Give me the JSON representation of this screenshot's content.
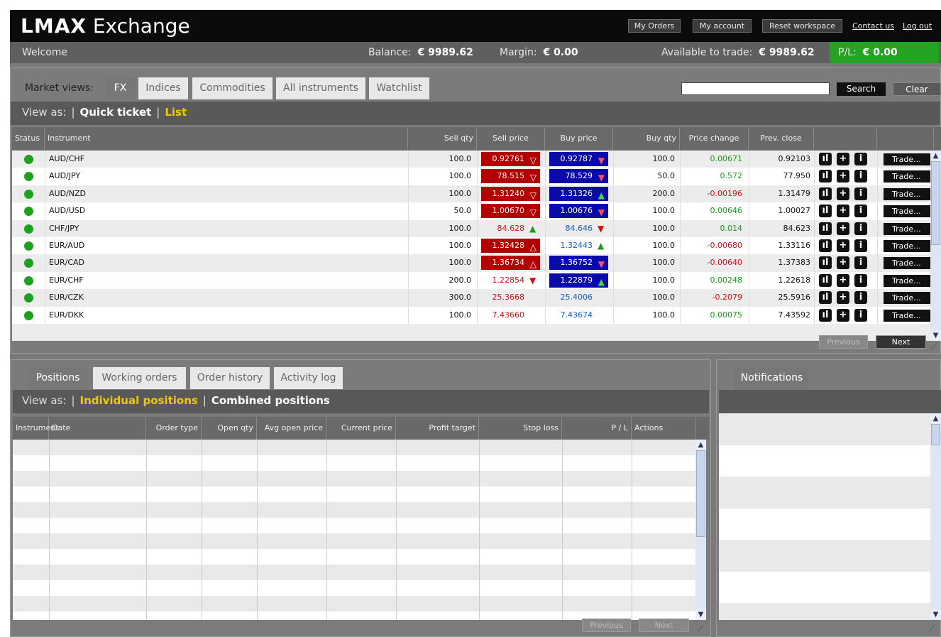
{
  "header": {
    "logo_bold": "LMAX",
    "logo_text": " Exchange",
    "buttons": {
      "my_orders": "My Orders",
      "my_account": "My account",
      "reset": "Reset workspace"
    },
    "links": {
      "contact": "Contact us",
      "logout": "Log out"
    }
  },
  "welcome_bar": {
    "welcome": "Welcome",
    "balance_label": "Balance:",
    "balance_value": "€ 9989.62",
    "margin_label": "Margin:",
    "margin_value": "€ 0.00",
    "available_label": "Available to trade:",
    "available_value": "€ 9989.62",
    "pl_label": "P/L:",
    "pl_value": "€ 0.00",
    "pl_color": "#22a422"
  },
  "market": {
    "views_label": "Market views:",
    "tabs": [
      "FX",
      "Indices",
      "Commodities",
      "All instruments",
      "Watchlist"
    ],
    "active_tab": "FX",
    "search_value": "",
    "search_button": "Search",
    "clear_button": "Clear",
    "view_as": "View as:",
    "view_options": {
      "quick_ticket": "Quick ticket",
      "list": "List"
    },
    "columns": {
      "status": "Status",
      "instrument": "Instrument",
      "sell_qty": "Sell qty",
      "sell_price": "Sell price",
      "buy_price": "Buy price",
      "buy_qty": "Buy qty",
      "price_change": "Price change",
      "prev_close": "Prev. close"
    },
    "rows": [
      {
        "instrument": "AUD/CHF",
        "sell_qty": "100.0",
        "sell_price": "0.92761",
        "sell_style": "red-box",
        "sell_arrow": "down-outline",
        "buy_price": "0.92787",
        "buy_style": "blue-box",
        "buy_arrow": "down",
        "buy_qty": "100.0",
        "change": "0.00671",
        "change_dir": "pos",
        "prev_close": "0.92103"
      },
      {
        "instrument": "AUD/JPY",
        "sell_qty": "100.0",
        "sell_price": "78.515",
        "sell_style": "red-box",
        "sell_arrow": "down-outline",
        "buy_price": "78.529",
        "buy_style": "blue-box",
        "buy_arrow": "down",
        "buy_qty": "50.0",
        "change": "0.572",
        "change_dir": "pos",
        "prev_close": "77.950"
      },
      {
        "instrument": "AUD/NZD",
        "sell_qty": "100.0",
        "sell_price": "1.31240",
        "sell_style": "red-box",
        "sell_arrow": "down-outline",
        "buy_price": "1.31326",
        "buy_style": "blue-box",
        "buy_arrow": "up",
        "buy_qty": "200.0",
        "change": "-0.00196",
        "change_dir": "neg",
        "prev_close": "1.31479"
      },
      {
        "instrument": "AUD/USD",
        "sell_qty": "50.0",
        "sell_price": "1.00670",
        "sell_style": "red-box",
        "sell_arrow": "down-outline",
        "buy_price": "1.00676",
        "buy_style": "blue-box",
        "buy_arrow": "down",
        "buy_qty": "100.0",
        "change": "0.00646",
        "change_dir": "pos",
        "prev_close": "1.00027"
      },
      {
        "instrument": "CHF/JPY",
        "sell_qty": "100.0",
        "sell_price": "84.628",
        "sell_style": "red-text",
        "sell_arrow": "up",
        "buy_price": "84.646",
        "buy_style": "blue-text",
        "buy_arrow": "down",
        "buy_qty": "100.0",
        "change": "0.014",
        "change_dir": "pos",
        "prev_close": "84.623"
      },
      {
        "instrument": "EUR/AUD",
        "sell_qty": "100.0",
        "sell_price": "1.32428",
        "sell_style": "red-box",
        "sell_arrow": "up-outline",
        "buy_price": "1.32443",
        "buy_style": "blue-text",
        "buy_arrow": "up",
        "buy_qty": "100.0",
        "change": "-0.00680",
        "change_dir": "neg",
        "prev_close": "1.33116"
      },
      {
        "instrument": "EUR/CAD",
        "sell_qty": "100.0",
        "sell_price": "1.36734",
        "sell_style": "red-box",
        "sell_arrow": "up-outline",
        "buy_price": "1.36752",
        "buy_style": "blue-box",
        "buy_arrow": "down",
        "buy_qty": "100.0",
        "change": "-0.00640",
        "change_dir": "neg",
        "prev_close": "1.37383"
      },
      {
        "instrument": "EUR/CHF",
        "sell_qty": "200.0",
        "sell_price": "1.22854",
        "sell_style": "red-text",
        "sell_arrow": "down",
        "buy_price": "1.22879",
        "buy_style": "blue-box",
        "buy_arrow": "up",
        "buy_qty": "100.0",
        "change": "0.00248",
        "change_dir": "pos",
        "prev_close": "1.22618"
      },
      {
        "instrument": "EUR/CZK",
        "sell_qty": "300.0",
        "sell_price": "25.3668",
        "sell_style": "red-text",
        "sell_arrow": "",
        "buy_price": "25.4006",
        "buy_style": "blue-text",
        "buy_arrow": "",
        "buy_qty": "100.0",
        "change": "-0.2079",
        "change_dir": "neg",
        "prev_close": "25.5916"
      },
      {
        "instrument": "EUR/DKK",
        "sell_qty": "100.0",
        "sell_price": "7.43660",
        "sell_style": "red-text",
        "sell_arrow": "",
        "buy_price": "7.43674",
        "buy_style": "blue-text",
        "buy_arrow": "",
        "buy_qty": "100.0",
        "change": "0.00075",
        "change_dir": "pos",
        "prev_close": "7.43592"
      }
    ],
    "trade_button": "Trade...",
    "pager": {
      "previous": "Previous",
      "next": "Next"
    },
    "row_icons": [
      "chart-icon",
      "plus-icon",
      "info-icon"
    ]
  },
  "positions": {
    "tabs": [
      "Positions",
      "Working orders",
      "Order history",
      "Activity log"
    ],
    "active_tab": "Positions",
    "view_as": "View as:",
    "view_options": {
      "individual": "Individual positions",
      "combined": "Combined positions"
    },
    "columns": [
      "Instrument",
      "Date",
      "Order type",
      "Open qty",
      "Avg open price",
      "Current price",
      "Profit target",
      "Stop loss",
      "P / L",
      "Actions"
    ],
    "pager": {
      "previous": "Previous",
      "next": "Next"
    }
  },
  "notifications": {
    "tab": "Notifications"
  },
  "colors": {
    "sell_box": "#b00000",
    "buy_box": "#0a0aa8",
    "positive": "#1a9a1a",
    "negative": "#d01010",
    "highlight": "#f2c800"
  }
}
